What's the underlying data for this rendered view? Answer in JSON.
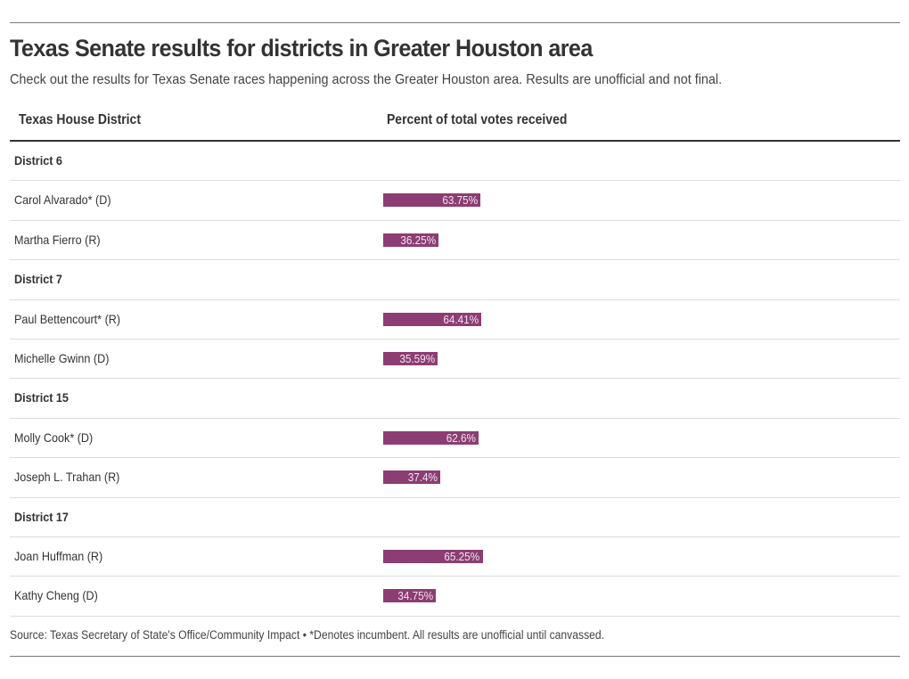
{
  "title": "Texas Senate results for districts in Greater Houston area",
  "subtitle": "Check out the results for Texas Senate races happening across the Greater Houston area. Results are unofficial and not final.",
  "columns": {
    "name": "Texas House District",
    "percent": "Percent of total votes received"
  },
  "colors": {
    "bar": "#8c3d73"
  },
  "rows": [
    {
      "type": "group",
      "label": "District 6"
    },
    {
      "type": "candidate",
      "label": "Carol Alvarado* (D)",
      "value": 63.75,
      "display": "63.75%"
    },
    {
      "type": "candidate",
      "label": "Martha Fierro (R)",
      "value": 36.25,
      "display": "36.25%"
    },
    {
      "type": "group",
      "label": "District 7"
    },
    {
      "type": "candidate",
      "label": "Paul Bettencourt* (R)",
      "value": 64.41,
      "display": "64.41%"
    },
    {
      "type": "candidate",
      "label": "Michelle Gwinn (D)",
      "value": 35.59,
      "display": "35.59%"
    },
    {
      "type": "group",
      "label": "District 15"
    },
    {
      "type": "candidate",
      "label": "Molly Cook* (D)",
      "value": 62.6,
      "display": "62.6%"
    },
    {
      "type": "candidate",
      "label": "Joseph L. Trahan (R)",
      "value": 37.4,
      "display": "37.4%"
    },
    {
      "type": "group",
      "label": "District 17"
    },
    {
      "type": "candidate",
      "label": "Joan Huffman (R)",
      "value": 65.25,
      "display": "65.25%"
    },
    {
      "type": "candidate",
      "label": "Kathy Cheng (D)",
      "value": 34.75,
      "display": "34.75%"
    }
  ],
  "footer": "Source: Texas Secretary of State's Office/Community Impact • *Denotes incumbent. All results are unofficial until canvassed.",
  "chart_data": {
    "type": "table",
    "title": "Texas Senate results for districts in Greater Houston area",
    "subtitle": "Check out the results for Texas Senate races happening across the Greater Houston area. Results are unofficial and not final.",
    "columns": [
      "Texas House District",
      "Percent of total votes received"
    ],
    "xlim": [
      0,
      100
    ],
    "groups": [
      {
        "name": "District 6",
        "candidates": [
          {
            "name": "Carol Alvarado* (D)",
            "value": 63.75
          },
          {
            "name": "Martha Fierro (R)",
            "value": 36.25
          }
        ]
      },
      {
        "name": "District 7",
        "candidates": [
          {
            "name": "Paul Bettencourt* (R)",
            "value": 64.41
          },
          {
            "name": "Michelle Gwinn (D)",
            "value": 35.59
          }
        ]
      },
      {
        "name": "District 15",
        "candidates": [
          {
            "name": "Molly Cook* (D)",
            "value": 62.6
          },
          {
            "name": "Joseph L. Trahan (R)",
            "value": 37.4
          }
        ]
      },
      {
        "name": "District 17",
        "candidates": [
          {
            "name": "Joan Huffman (R)",
            "value": 65.25
          },
          {
            "name": "Kathy Cheng (D)",
            "value": 34.75
          }
        ]
      }
    ],
    "annotations": [
      "Source: Texas Secretary of State's Office/Community Impact • *Denotes incumbent. All results are unofficial until canvassed."
    ]
  }
}
